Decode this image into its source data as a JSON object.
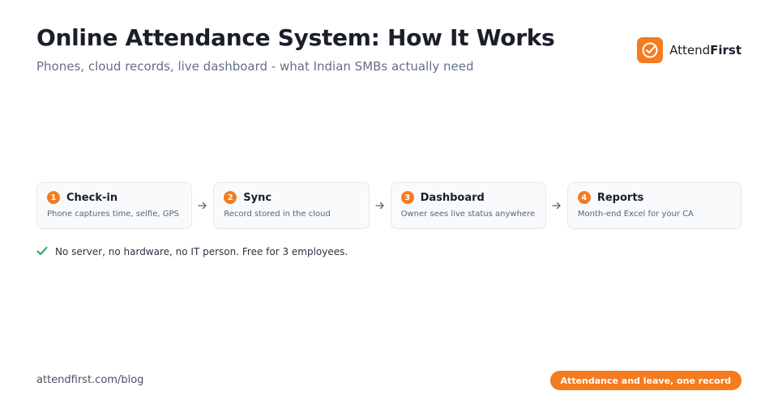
{
  "header": {
    "title": "Online Attendance System: How It Works",
    "subtitle": "Phones, cloud records, live dashboard - what Indian SMBs actually need"
  },
  "brand": {
    "name_regular": "Attend",
    "name_bold": "First",
    "logo_icon": "check-circle-icon",
    "accent_color": "#f47b20"
  },
  "steps": [
    {
      "number": "1",
      "title": "Check-in",
      "description": "Phone captures time, selfie, GPS"
    },
    {
      "number": "2",
      "title": "Sync",
      "description": "Record stored in the cloud"
    },
    {
      "number": "3",
      "title": "Dashboard",
      "description": "Owner sees live status anywhere"
    },
    {
      "number": "4",
      "title": "Reports",
      "description": "Month-end Excel for your CA"
    }
  ],
  "note": {
    "icon": "check-icon",
    "text": "No server, no hardware, no IT person. Free for 3 employees.",
    "icon_color": "#22a55a"
  },
  "footer": {
    "url": "attendfirst.com/blog",
    "cta_label": "Attendance and leave, one record"
  }
}
